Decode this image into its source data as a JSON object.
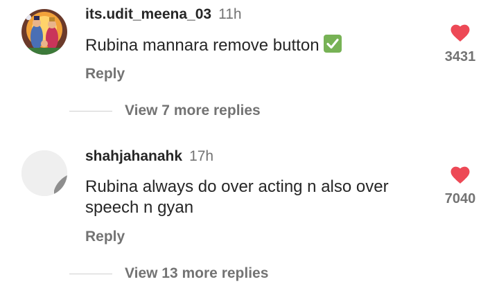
{
  "comments": [
    {
      "username": "its.udit_meena_03",
      "time": "11h",
      "text": "Rubina mannara remove button",
      "emoji": "check-mark-button",
      "reply_label": "Reply",
      "view_replies": "View 7 more replies",
      "likes": "3431",
      "liked": true
    },
    {
      "username": "shahjahanahk",
      "time": "17h",
      "text": "Rubina always do over acting n also over speech n gyan",
      "reply_label": "Reply",
      "view_replies": "View 13 more replies",
      "likes": "7040",
      "liked": true
    }
  ],
  "colors": {
    "heart": "#ed4956",
    "secondary_text": "#737373",
    "primary_text": "#262626",
    "check_badge": "#77b255"
  },
  "icons": [
    "heart-icon",
    "check-mark-icon",
    "avatar-image"
  ]
}
